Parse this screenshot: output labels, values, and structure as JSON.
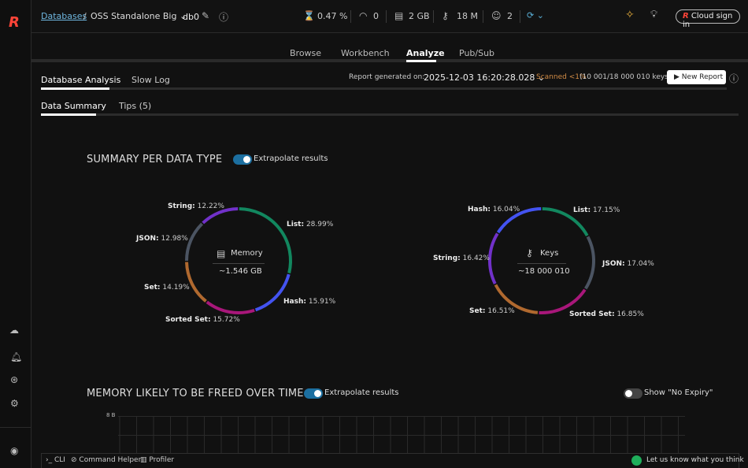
{
  "header": {
    "breadcrumb_root": "Databases",
    "database": "OSS Standalone Big",
    "db_index": "db0",
    "cpu": "0.47 %",
    "ops": "0",
    "memory": "2 GB",
    "keys": "18 M",
    "clients": "2",
    "cloud_sign_in": "Cloud sign in"
  },
  "nav_tabs": [
    {
      "label": "Browse"
    },
    {
      "label": "Workbench"
    },
    {
      "label": "Analyze",
      "active": true
    },
    {
      "label": "Pub/Sub"
    }
  ],
  "sub_tabs": [
    {
      "label": "Database Analysis",
      "active": true
    },
    {
      "label": "Slow Log"
    }
  ],
  "report": {
    "generated_label": "Report generated on:",
    "date": "2025-12-03 16:20:28.028",
    "scanned": "Scanned <1%",
    "scanned_detail": "(10 001/18 000 010 keys)",
    "new_report": "New Report"
  },
  "inner_tabs": [
    {
      "label": "Data Summary",
      "active": true
    },
    {
      "label": "Tips (5)"
    }
  ],
  "summary": {
    "title": "SUMMARY PER DATA TYPE",
    "extrapolate": "Extrapolate results",
    "extrapolate_on": true
  },
  "colors": {
    "List": "#12875f",
    "Hash": "#4353f0",
    "Sorted Set": "#a8177a",
    "Set": "#b0692f",
    "JSON": "#4b5462",
    "String": "#7131c9",
    "accent": "#1c6fa0",
    "warning": "#d18b45"
  },
  "chart_data": [
    {
      "type": "pie",
      "title": "Memory",
      "total": "~1.546 GB",
      "slices": [
        {
          "label": "List",
          "value": 28.99,
          "text": "List:",
          "pct": "28.99%"
        },
        {
          "label": "Hash",
          "value": 15.91,
          "text": "Hash:",
          "pct": "15.91%"
        },
        {
          "label": "Sorted Set",
          "value": 15.72,
          "text": "Sorted Set:",
          "pct": "15.72%"
        },
        {
          "label": "Set",
          "value": 14.19,
          "text": "Set:",
          "pct": "14.19%"
        },
        {
          "label": "JSON",
          "value": 12.98,
          "text": "JSON:",
          "pct": "12.98%"
        },
        {
          "label": "String",
          "value": 12.22,
          "text": "String:",
          "pct": "12.22%"
        }
      ]
    },
    {
      "type": "pie",
      "title": "Keys",
      "total": "~18 000 010",
      "slices": [
        {
          "label": "List",
          "value": 17.15,
          "text": "List:",
          "pct": "17.15%"
        },
        {
          "label": "JSON",
          "value": 17.04,
          "text": "JSON:",
          "pct": "17.04%"
        },
        {
          "label": "Sorted Set",
          "value": 16.85,
          "text": "Sorted Set:",
          "pct": "16.85%"
        },
        {
          "label": "Set",
          "value": 16.51,
          "text": "Set:",
          "pct": "16.51%"
        },
        {
          "label": "String",
          "value": 16.42,
          "text": "String:",
          "pct": "16.42%"
        },
        {
          "label": "Hash",
          "value": 16.04,
          "text": "Hash:",
          "pct": "16.04%"
        }
      ]
    },
    {
      "type": "bar",
      "title": "MEMORY LIKELY TO BE FREED OVER TIME",
      "ytick": "8 B"
    }
  ],
  "freed": {
    "title": "MEMORY LIKELY TO BE FREED OVER TIME",
    "extrapolate": "Extrapolate results",
    "no_expiry": "Show \"No Expiry\"",
    "ytick": "8 B"
  },
  "footer": {
    "cli": "CLI",
    "command_helper": "Command Helper",
    "profiler": "Profiler",
    "feedback": "Let us know what you think"
  }
}
